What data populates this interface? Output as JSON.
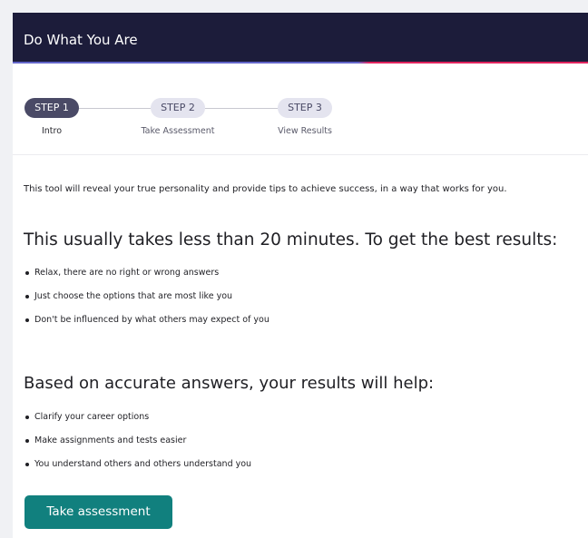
{
  "header": {
    "title": "Do What You Are",
    "accent_left_color": "#6366c9",
    "accent_right_color": "#e0245e",
    "background_color": "#1c1c3a"
  },
  "stepper": {
    "steps": [
      {
        "pill": "STEP 1",
        "label": "Intro",
        "state": "active"
      },
      {
        "pill": "STEP 2",
        "label": "Take Assessment",
        "state": "inactive"
      },
      {
        "pill": "STEP 3",
        "label": "View Results",
        "state": "inactive"
      }
    ]
  },
  "content": {
    "intro": "This tool will reveal your true personality and provide tips to achieve success, in a way that works for you.",
    "heading1": "This usually takes less than 20 minutes. To get the best results:",
    "tips": [
      "Relax, there are no right or wrong answers",
      "Just choose the options that are most like you",
      "Don't be influenced by what others may expect of you"
    ],
    "heading2": "Based on accurate answers, your results will help:",
    "benefits": [
      "Clarify your career options",
      "Make assignments and tests easier",
      "You understand others and others understand you"
    ]
  },
  "cta": {
    "label": "Take assessment",
    "color": "#11807e"
  }
}
